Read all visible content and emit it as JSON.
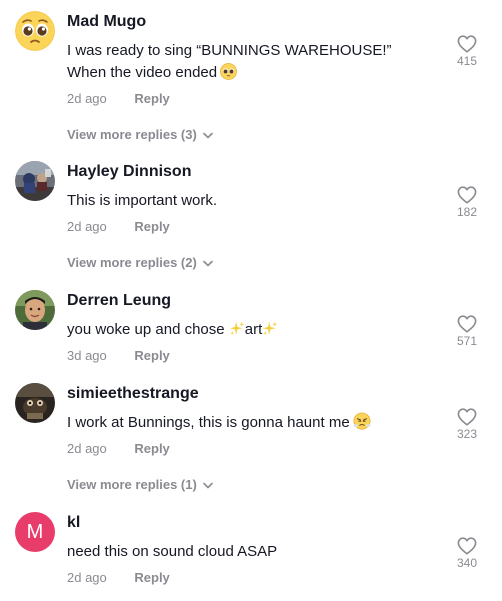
{
  "comments": [
    {
      "username": "Mad Mugo",
      "text_line1": "I was ready to sing “BUNNINGS WAREHOUSE!”",
      "text_line2": "When the video ended",
      "time": "2d ago",
      "reply_label": "Reply",
      "likes": "415",
      "avatar": "pleading-face-emoji",
      "emoji": "pleading-face-emoji",
      "view_more": "View more replies (3)"
    },
    {
      "username": "Hayley Dinnison",
      "text": "This is important work.",
      "time": "2d ago",
      "reply_label": "Reply",
      "likes": "182",
      "avatar": "photo-avatar",
      "view_more": "View more replies (2)"
    },
    {
      "username": "Derren Leung",
      "text_before": "you woke up and chose ",
      "text_mid": "art",
      "time": "3d ago",
      "reply_label": "Reply",
      "likes": "571",
      "avatar": "photo-avatar",
      "emoji": "sparkles-emoji"
    },
    {
      "username": "simieethestrange",
      "text": "I work at Bunnings, this is gonna haunt me",
      "time": "2d ago",
      "reply_label": "Reply",
      "likes": "323",
      "avatar": "photo-avatar",
      "emoji": "steam-face-emoji",
      "view_more": "View more replies (1)"
    },
    {
      "username": "kl",
      "text": "need this on sound cloud ASAP",
      "time": "2d ago",
      "reply_label": "Reply",
      "likes": "340",
      "avatar_letter": "M",
      "avatar_color": "#e83c6a"
    }
  ],
  "colors": {
    "primary_text": "#161823",
    "secondary_text": "#8a8b91",
    "avatar_pink": "#e83c6a"
  }
}
